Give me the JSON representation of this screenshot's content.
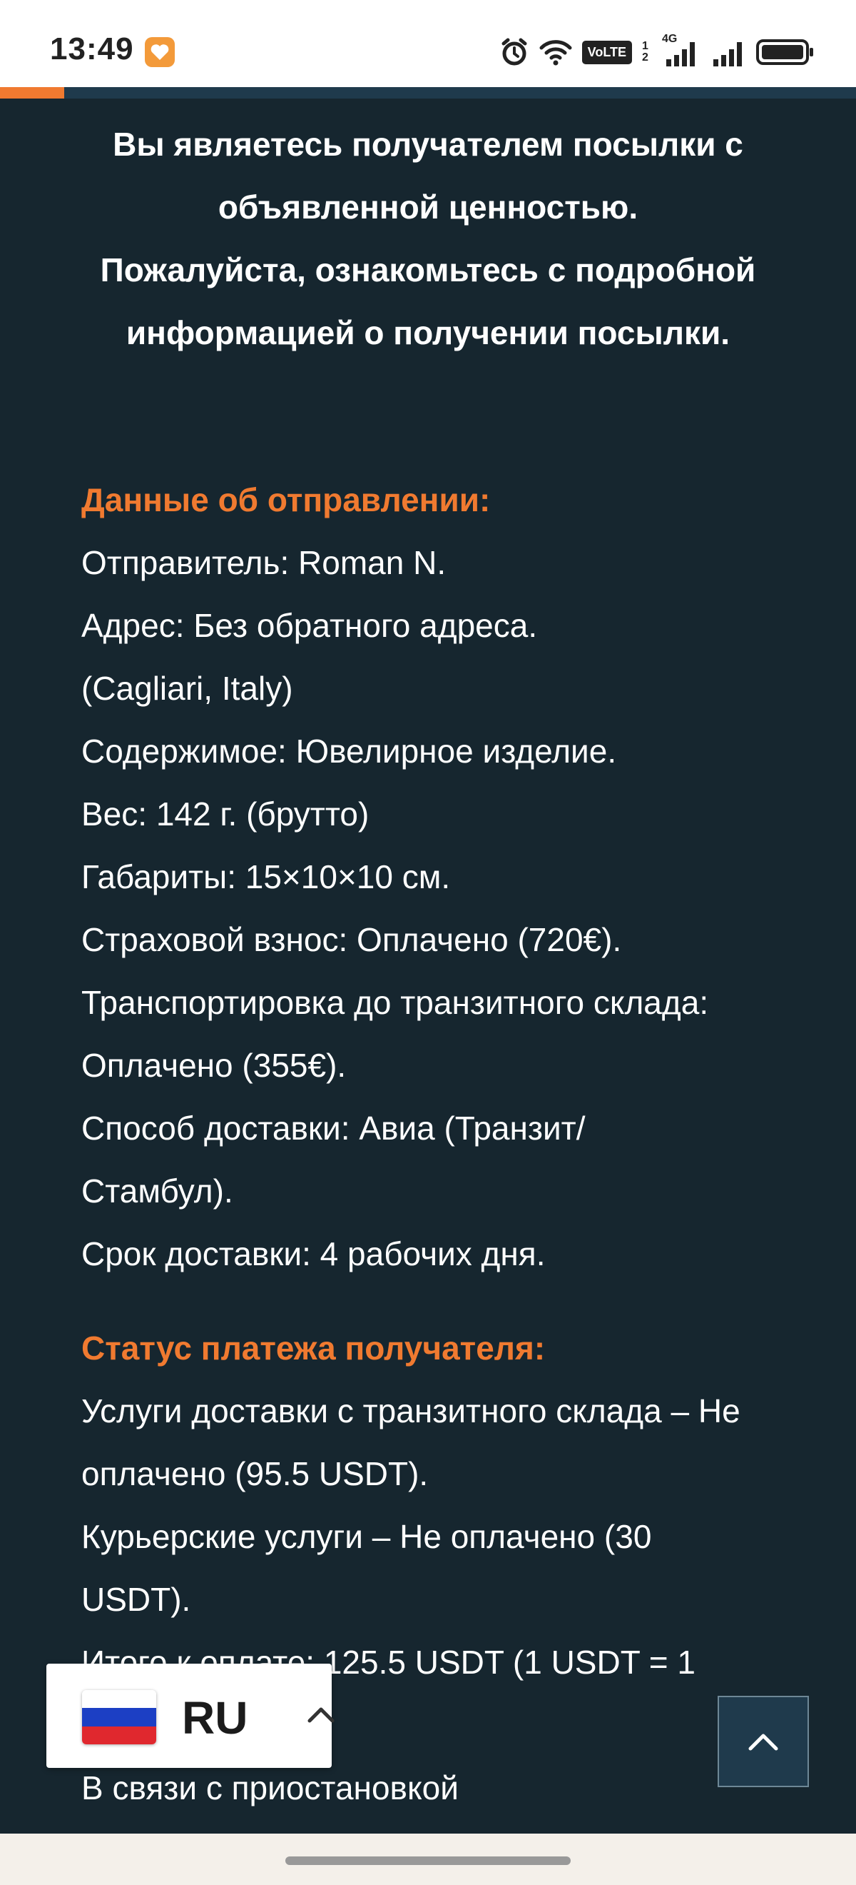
{
  "status_bar": {
    "time": "13:49",
    "volte": "VoLTE",
    "sim_indicator": "1 2",
    "network": "4G"
  },
  "intro": {
    "line1": "Вы являетесь получателем посылки с объявленной ценностью.",
    "line2": "Пожалуйста, ознакомьтесь с подробной информацией о получении посылки."
  },
  "shipment": {
    "heading": "Данные об отправлении:",
    "sender": "Отправитель: Roman N.",
    "address": "Адрес: Без обратного адреса. (Cagliari, Italy)",
    "contents": "Содержимое: Ювелирное изделие.",
    "weight": "Вес: 142 г. (брутто)",
    "dimensions": "Габариты: 15×10×10 см.",
    "insurance": "Страховой взнос: Оплачено (720€).",
    "transport": "Транспортировка до транзитного склада: Оплачено (355€).",
    "method": "Способ доставки: Авиа (Транзит/ Стамбул).",
    "term": "Срок доставки: 4 рабочих дня."
  },
  "payment": {
    "heading": "Статус платежа получателя:",
    "line1": "Услуги доставки с транзитного склада – Не оплачено (95.5 USDT).",
    "line2": "Курьерские услуги – Не оплачено (30 USDT).",
    "line3": "Итого к оплате: 125.5 USDT (1 USDT = 1",
    "line4": "В связи с приостановкой"
  },
  "language_selector": {
    "code": "RU",
    "flag_icon": "russia-flag-icon"
  },
  "colors": {
    "background": "#16262f",
    "accent": "#f07a30",
    "text": "#ffffff"
  }
}
